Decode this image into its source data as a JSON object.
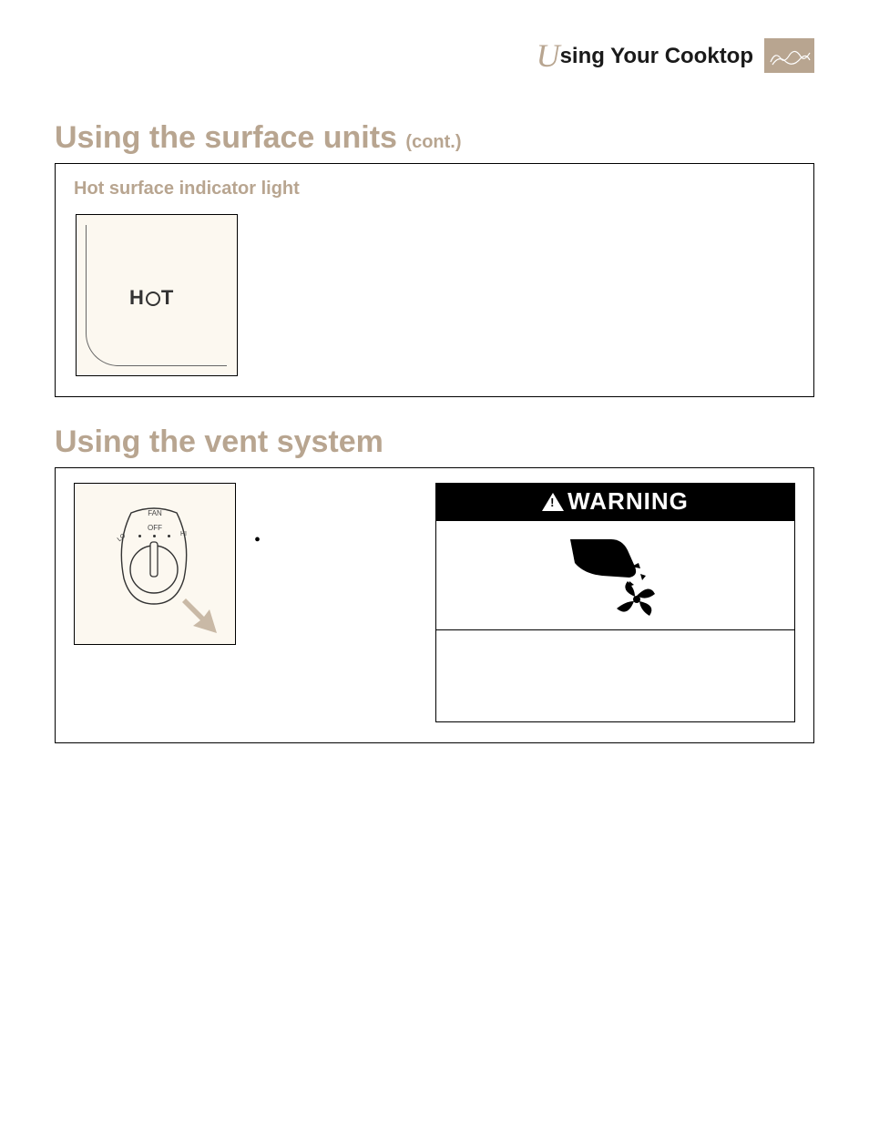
{
  "header": {
    "script_letter": "U",
    "title_rest": "sing Your Cooktop"
  },
  "section1": {
    "heading_main": "Using the surface units",
    "heading_cont": "(cont.)",
    "sub_heading": "Hot surface indicator light",
    "hot_label_h": "H",
    "hot_label_t": "T"
  },
  "section2": {
    "heading": "Using the vent system",
    "fan_label": "FAN",
    "off_label": "OFF",
    "lo_label": "LO",
    "hi_label": "HI",
    "warning_label": "WARNING"
  }
}
